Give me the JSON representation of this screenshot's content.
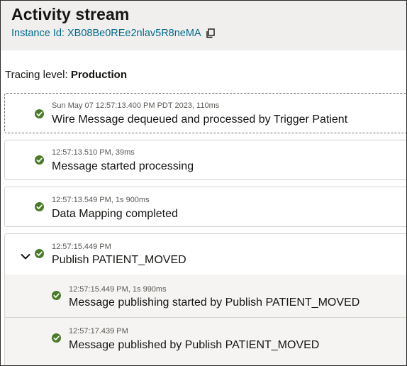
{
  "header": {
    "title": "Activity stream",
    "instance_id": "Instance Id: XB08Be0REe2nlav5R8neMA",
    "copy_icon": "copy-icon"
  },
  "tracing": {
    "label": "Tracing level:",
    "value": "Production"
  },
  "colors": {
    "accent_link": "#006b8f",
    "success": "#4a7a2a",
    "header_bg": "#f1efed"
  },
  "activities": [
    {
      "timestamp": "Sun May 07 12:57:13.400 PM PDT 2023, 110ms",
      "message": "Wire Message dequeued and processed by Trigger Patient",
      "status_icon": "success-check-icon"
    },
    {
      "timestamp": "12:57:13.510 PM, 39ms",
      "message": "Message started processing",
      "status_icon": "success-check-icon"
    },
    {
      "timestamp": "12:57:13.549 PM, 1s 900ms",
      "message": "Data Mapping completed",
      "status_icon": "success-check-icon"
    },
    {
      "timestamp": "12:57:15.449 PM",
      "message": "Publish PATIENT_MOVED",
      "status_icon": "success-check-icon",
      "expanded": true,
      "expand_icon": "chevron-down-icon",
      "children": [
        {
          "timestamp": "12:57:15.449 PM, 1s 990ms",
          "message": "Message publishing started by Publish PATIENT_MOVED",
          "status_icon": "success-check-icon"
        },
        {
          "timestamp": "12:57:17.439 PM",
          "message": "Message published by Publish PATIENT_MOVED",
          "status_icon": "success-check-icon"
        }
      ]
    }
  ]
}
